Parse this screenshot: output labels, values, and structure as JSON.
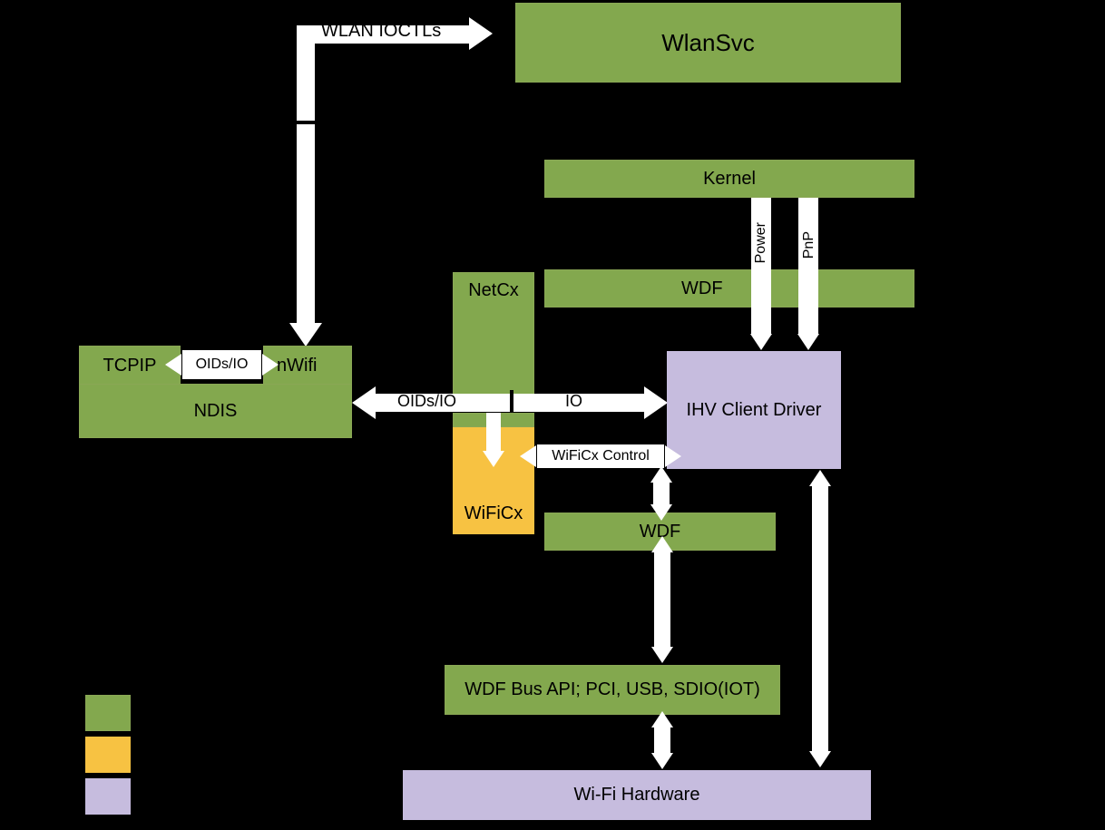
{
  "boxes": {
    "wlansvc": "WlanSvc",
    "tcpip": "TCPIP",
    "nwifi": "nWifi",
    "ndis": "NDIS",
    "kernel": "Kernel",
    "netcx": "NetCx",
    "wdf_top": "WDF",
    "wificx": "WiFiCx",
    "ihv": "IHV Client Driver",
    "wdf_mid": "WDF",
    "bus": "WDF Bus API; PCI, USB, SDIO(IOT)",
    "hw": "Wi-Fi Hardware"
  },
  "labels": {
    "wlan_ioctls": "WLAN IOCTLs",
    "oids_io_small": "OIDs/IO",
    "oids_io": "OIDs/IO",
    "io": "IO",
    "wificx_control": "WiFiCx Control",
    "power": "Power",
    "pnp": "PnP"
  },
  "colors": {
    "green": "#83a84e",
    "yellow": "#f7c242",
    "purple": "#c6bcde"
  }
}
